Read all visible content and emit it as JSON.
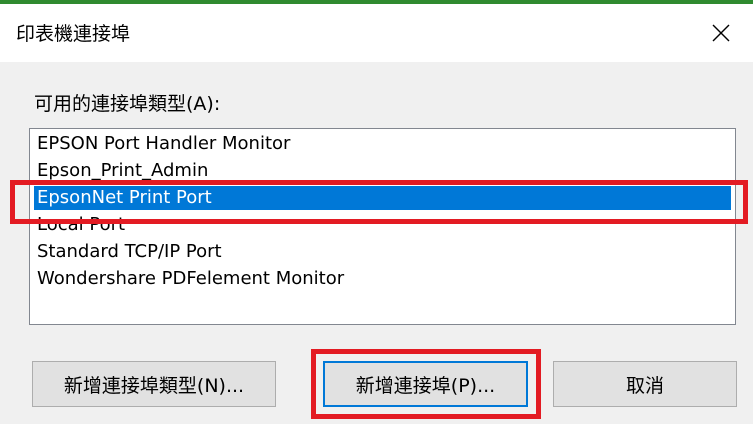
{
  "dialog": {
    "title": "印表機連接埠",
    "close_icon": "close-icon"
  },
  "port_types": {
    "label": "可用的連接埠類型(A):",
    "items": [
      "EPSON Port Handler Monitor",
      "Epson_Print_Admin",
      "EpsonNet Print Port",
      "Local Port",
      "Standard TCP/IP Port",
      "Wondershare PDFelement Monitor"
    ],
    "selected_index": 2
  },
  "buttons": {
    "new_port_type": "新增連接埠類型(N)...",
    "new_port": "新增連接埠(P)...",
    "cancel": "取消"
  },
  "colors": {
    "selection": "#0078d7",
    "highlight_box": "#e31b23"
  }
}
